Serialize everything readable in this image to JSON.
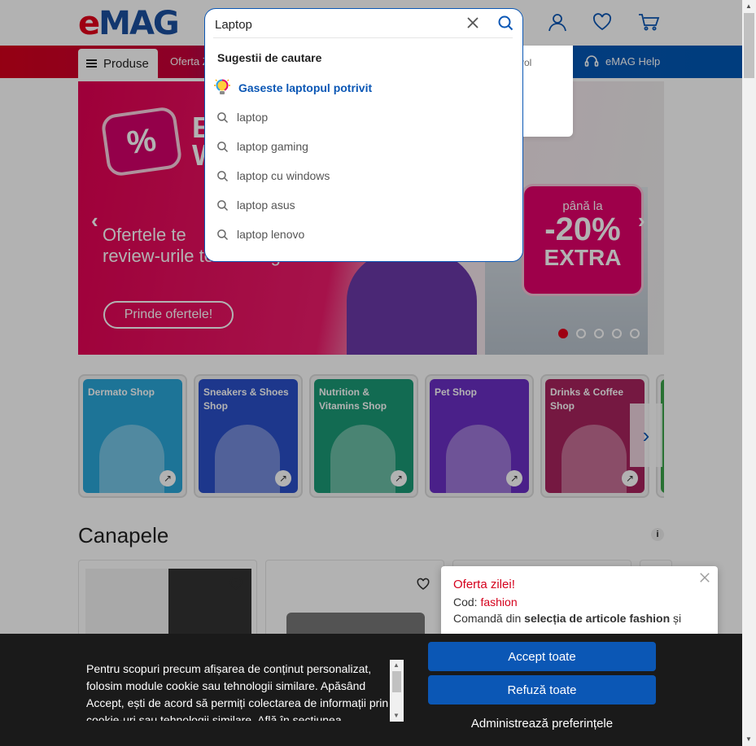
{
  "header": {
    "logo": {
      "e": "e",
      "rest": "MAG"
    }
  },
  "nav": {
    "produse_label": "Produse",
    "links": [
      "Oferta Z",
      "eMAG Help"
    ]
  },
  "user_menu_fragment": "rol",
  "search": {
    "value": "Laptop",
    "suggestions_title": "Sugestii de cautare",
    "featured_suggestion": "Gaseste laptopul potrivit",
    "suggestions": [
      "laptop",
      "laptop gaming",
      "laptop cu windows",
      "laptop asus",
      "laptop lenovo"
    ]
  },
  "hero": {
    "title_fragment": [
      "E",
      "W"
    ],
    "text_lines": [
      "Ofertele te",
      "review-urile te conving"
    ],
    "cta": "Prinde ofertele!",
    "promo": {
      "line1": "până la",
      "line2": "-20%",
      "line3": "EXTRA"
    },
    "slide_count": 5,
    "active_slide": 1
  },
  "shop_tiles": [
    {
      "label": "Dermato Shop",
      "color": "#2aa7d8"
    },
    {
      "label": "Sneakers & Shoes Shop",
      "color": "#2a4fc9"
    },
    {
      "label": "Nutrition & Vitamins Shop",
      "color": "#1b9a76"
    },
    {
      "label": "Pet Shop",
      "color": "#6b2fc4"
    },
    {
      "label": "Drinks & Coffee Shop",
      "color": "#a8235d"
    }
  ],
  "section": {
    "title": "Canapele",
    "info": "i"
  },
  "offer": {
    "title": "Oferta zilei!",
    "code_label": "Cod:",
    "code_value": "fashion",
    "desc_prefix": "Comandă din ",
    "desc_bold": "selecția de articole fashion",
    "desc_suffix": " și"
  },
  "cookie": {
    "text": "Pentru scopuri precum afișarea de conținut personalizat, folosim module cookie sau tehnologii similare. Apăsând Accept, ești de acord să permiți colectarea de informații prin cookie-uri sau tehnologii similare. Află în secțiunea",
    "accept": "Accept toate",
    "refuse": "Refuză toate",
    "manage": "Administrează preferințele"
  },
  "colors": {
    "brand_blue": "#0b57b5",
    "brand_red": "#e3001b",
    "cookie_bg": "#1a1a1a"
  },
  "icons": [
    "user-icon",
    "heart-icon",
    "cart-icon",
    "search-icon",
    "close-icon",
    "lightbulb-icon",
    "chevron-left-icon",
    "chevron-right-icon",
    "arrow-out-icon",
    "info-icon"
  ]
}
